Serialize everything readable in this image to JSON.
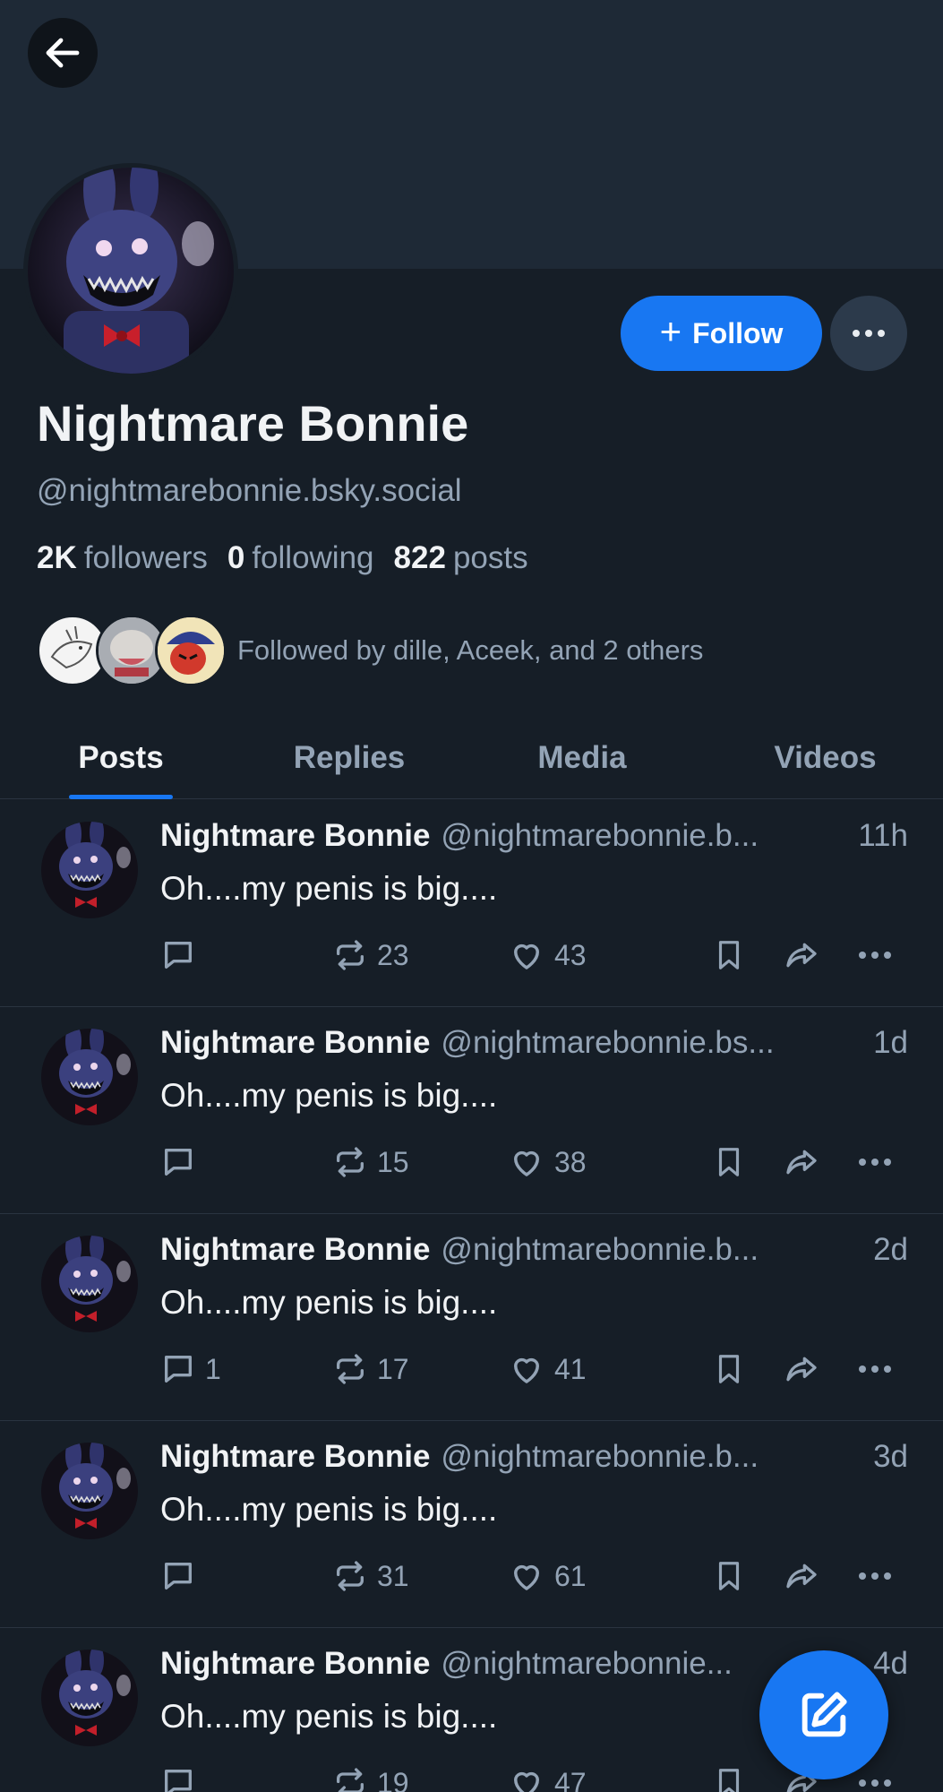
{
  "profile": {
    "display_name": "Nightmare Bonnie",
    "handle": "@nightmarebonnie.bsky.social",
    "stats": {
      "followers_count": "2K",
      "followers_label": "followers",
      "following_count": "0",
      "following_label": "following",
      "posts_count": "822",
      "posts_label": "posts"
    },
    "followed_by": "Followed by dille, Aceek, and 2 others",
    "follow_button": "Follow"
  },
  "tabs": [
    {
      "label": "Posts",
      "active": true
    },
    {
      "label": "Replies",
      "active": false
    },
    {
      "label": "Media",
      "active": false
    },
    {
      "label": "Videos",
      "active": false
    }
  ],
  "posts": [
    {
      "name": "Nightmare Bonnie",
      "handle": "@nightmarebonnie.b...",
      "time": "11h",
      "text": "Oh....my penis is big....",
      "replies": "",
      "reposts": "23",
      "likes": "43"
    },
    {
      "name": "Nightmare Bonnie",
      "handle": "@nightmarebonnie.bs...",
      "time": "1d",
      "text": "Oh....my penis is big....",
      "replies": "",
      "reposts": "15",
      "likes": "38"
    },
    {
      "name": "Nightmare Bonnie",
      "handle": "@nightmarebonnie.b...",
      "time": "2d",
      "text": "Oh....my penis is big....",
      "replies": "1",
      "reposts": "17",
      "likes": "41"
    },
    {
      "name": "Nightmare Bonnie",
      "handle": "@nightmarebonnie.b...",
      "time": "3d",
      "text": "Oh....my penis is big....",
      "replies": "",
      "reposts": "31",
      "likes": "61"
    },
    {
      "name": "Nightmare Bonnie",
      "handle": "@nightmarebonnie...",
      "time": "4d",
      "text": "Oh....my penis is big....",
      "replies": "",
      "reposts": "19",
      "likes": "47"
    }
  ],
  "colors": {
    "background": "#161e27",
    "banner": "#1e2936",
    "accent": "#1877f2",
    "muted_text": "#93a3b5"
  },
  "icons": [
    "back-arrow-icon",
    "plus-icon",
    "ellipsis-icon",
    "reply-icon",
    "repost-icon",
    "like-icon",
    "bookmark-icon",
    "share-icon",
    "compose-icon"
  ]
}
